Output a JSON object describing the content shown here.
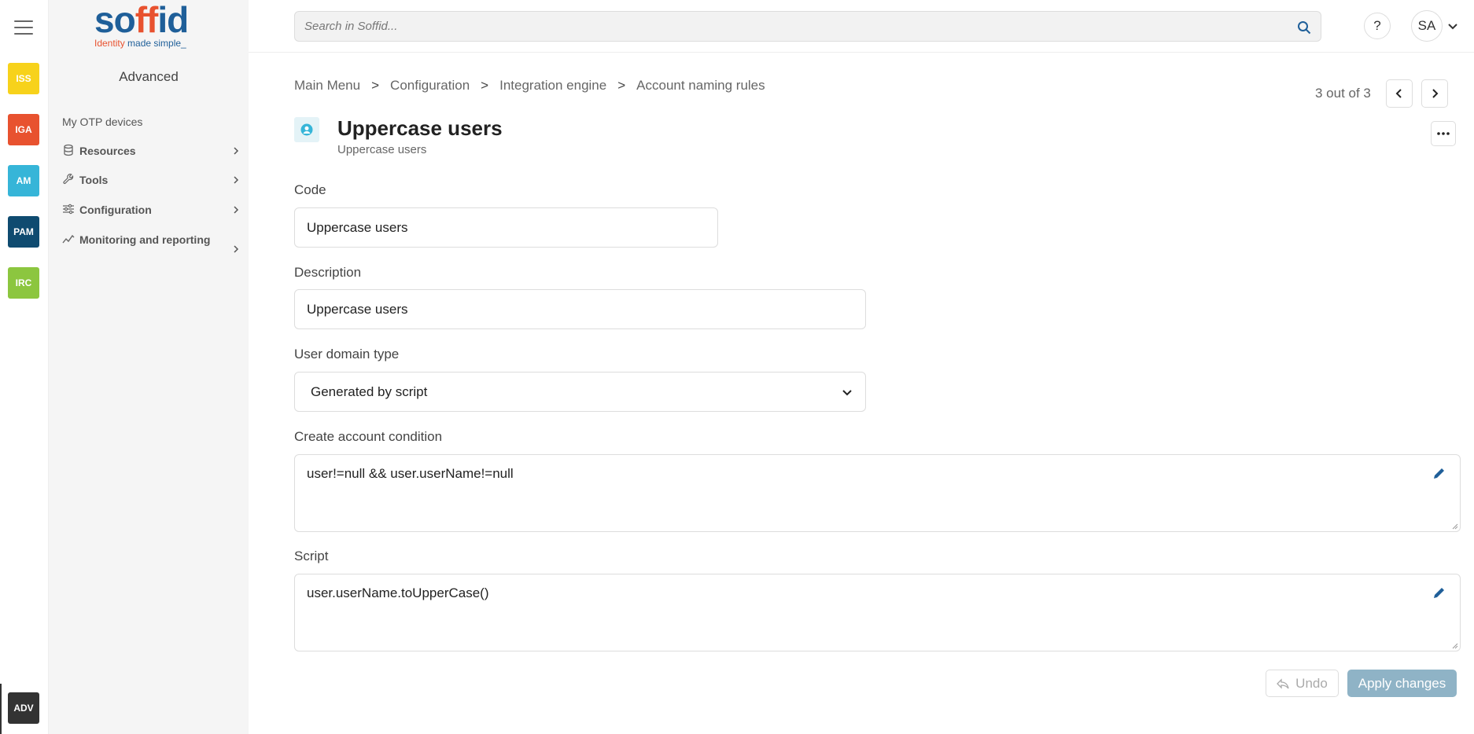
{
  "apps": [
    {
      "label": "ISS",
      "color": "#f7d21b"
    },
    {
      "label": "IGA",
      "color": "#e8522f"
    },
    {
      "label": "AM",
      "color": "#36b5d8"
    },
    {
      "label": "PAM",
      "color": "#0f4b70"
    },
    {
      "label": "IRC",
      "color": "#8cc63f"
    },
    {
      "label": "ADV",
      "color": "#333333"
    }
  ],
  "logo": {
    "brand": "soffid",
    "tagline_a": "Identity ",
    "tagline_b": "made simple_"
  },
  "sidebar": {
    "title": "Advanced",
    "link": "My OTP devices",
    "items": [
      {
        "label": "Resources",
        "icon": "database-icon"
      },
      {
        "label": "Tools",
        "icon": "wrench-icon"
      },
      {
        "label": "Configuration",
        "icon": "sliders-icon"
      },
      {
        "label": "Monitoring and reporting",
        "icon": "chart-line-icon"
      }
    ]
  },
  "topbar": {
    "search_placeholder": "Search in Soffid...",
    "help_label": "?",
    "user_initials": "SA"
  },
  "breadcrumb": [
    "Main Menu",
    "Configuration",
    "Integration engine",
    "Account naming rules"
  ],
  "breadcrumb_separator": ">",
  "pager": {
    "text": "3 out of 3"
  },
  "record": {
    "title": "Uppercase users",
    "subtitle": "Uppercase users"
  },
  "form": {
    "code": {
      "label": "Code",
      "value": "Uppercase users"
    },
    "description": {
      "label": "Description",
      "value": "Uppercase users"
    },
    "user_domain_type": {
      "label": "User domain type",
      "value": "Generated by script"
    },
    "create_condition": {
      "label": "Create account condition",
      "value": "user!=null && user.userName!=null"
    },
    "script": {
      "label": "Script",
      "value": "user.userName.toUpperCase()"
    }
  },
  "actions": {
    "undo": "Undo",
    "apply": "Apply changes"
  },
  "colors": {
    "accent": "#1f5f99",
    "brand_orange": "#e8522f",
    "apply_button": "#8fb3c6",
    "title_icon": "#36b5d8"
  }
}
